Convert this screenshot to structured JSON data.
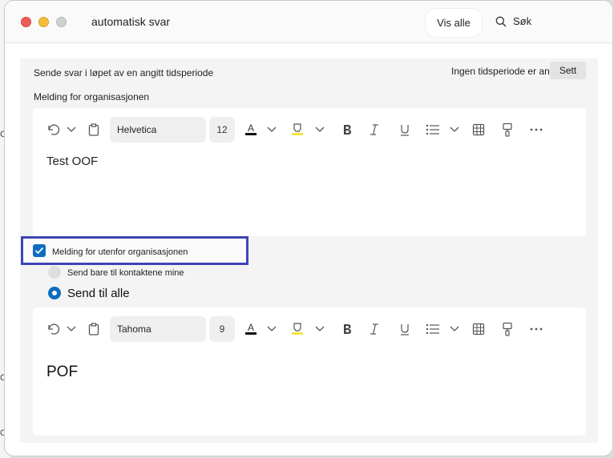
{
  "window": {
    "title": "automatisk svar"
  },
  "header": {
    "show_all_label": "Vis alle",
    "search_label": "Søk"
  },
  "settings": {
    "period_label": "Sende svar i løpet av en angitt tidsperiode",
    "period_status": "Ingen tidsperiode er angitt",
    "set_button_label": "Sett",
    "org_message_label": "Melding for organisasjonen"
  },
  "editor_internal": {
    "font": "Helvetica",
    "size": "12",
    "body": "Test OOF"
  },
  "external": {
    "checkbox_label": "Melding for utenfor organisasjonen",
    "checked": true,
    "radio_contacts_label": "Send bare til kontaktene mine",
    "radio_all_label": "Send til alle",
    "selected": "all"
  },
  "editor_external": {
    "font": "Tahoma",
    "size": "9",
    "body": "POF"
  },
  "colors": {
    "accent": "#0f6cbd",
    "highlight_outline": "#3f45b5",
    "highlighter": "#f2e53a"
  },
  "icons": [
    "undo-icon",
    "chevron-down-icon",
    "clipboard-icon",
    "font-color-icon",
    "highlighter-icon",
    "bold-icon",
    "italic-icon",
    "underline-icon",
    "bullets-icon",
    "table-icon",
    "format-painter-icon",
    "more-icon",
    "search-icon",
    "checkmark-icon"
  ]
}
